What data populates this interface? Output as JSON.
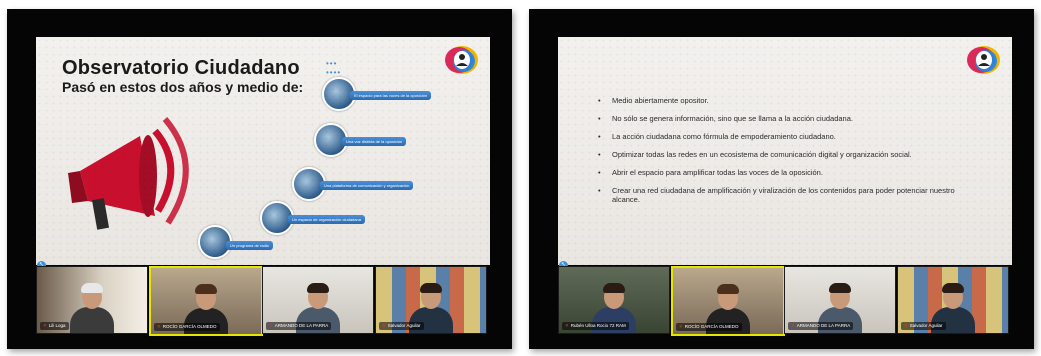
{
  "left": {
    "slide": {
      "title": "Observatorio Ciudadano",
      "subtitle": "Pasó en estos dos años y medio de:",
      "steps": [
        "Un programa de radio",
        "Un espacio de organización ciudadana",
        "Una plataforma de comunicación y organización",
        "Una voz distinta de la oposición",
        "El espacio para las voces de la oposición"
      ]
    },
    "participants": [
      {
        "name": "Lili Loga"
      },
      {
        "name": "ROCÍO GARCÍA OLMEDO"
      },
      {
        "name": "ARMANDO DE LA PARRA"
      },
      {
        "name": "Salvador Aguilar"
      }
    ]
  },
  "right": {
    "slide": {
      "bullets": [
        "Medio abiertamente opositor.",
        "No sólo se genera información, sino que se llama a la acción ciudadana.",
        "La acción ciudadana como fórmula de empoderamiento ciudadano.",
        "Optimizar todas las redes en un ecosistema de comunicación digital y organización social.",
        "Abrir el espacio para amplificar todas las voces de la oposición.",
        "Crear una red ciudadana de amplificación y viralización de los contenidos para poder potenciar nuestro alcance."
      ]
    },
    "participants": [
      {
        "name": "Rubén Ulloa Rocio 72 RAM"
      },
      {
        "name": "ROCÍO GARCÍA OLMEDO"
      },
      {
        "name": "ARMANDO DE LA PARRA"
      },
      {
        "name": "Salvador Aguilar"
      }
    ]
  },
  "colors": {
    "accent": "#2b6cb3",
    "megaphone": "#c8102e",
    "frame": "#050505"
  },
  "icons": [
    "logo-icon",
    "megaphone-icon",
    "mic-muted-icon"
  ]
}
